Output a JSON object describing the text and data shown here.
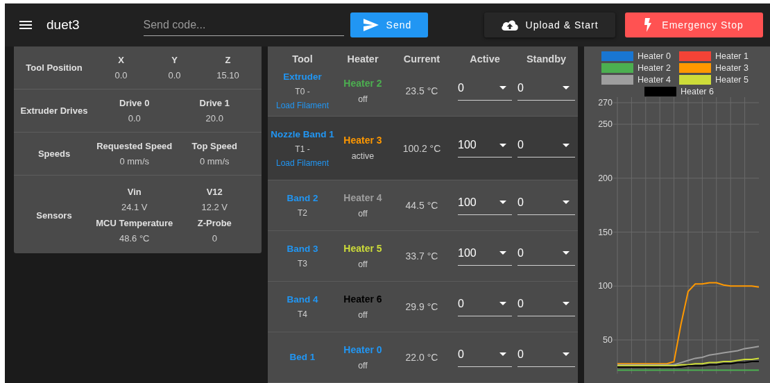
{
  "app_bar": {
    "title": "duet3",
    "code_field": {
      "placeholder": "Send code..."
    },
    "send_button": "Send",
    "upload_button": "Upload & Start",
    "emergency_button": "Emergency Stop"
  },
  "machine_status": {
    "tool_position": {
      "label": "Tool Position",
      "axes": [
        {
          "heading": "X",
          "value": "0.0"
        },
        {
          "heading": "Y",
          "value": "0.0"
        },
        {
          "heading": "Z",
          "value": "15.10"
        }
      ]
    },
    "rows": [
      {
        "label": "Extruder Drives",
        "cells": [
          {
            "heading": "Drive 0",
            "value": "0.0"
          },
          {
            "heading": "Drive 1",
            "value": "20.0"
          }
        ]
      },
      {
        "label": "Speeds",
        "cells": [
          {
            "heading": "Requested Speed",
            "value": "0 mm/s"
          },
          {
            "heading": "Top Speed",
            "value": "0 mm/s"
          }
        ]
      },
      {
        "label": "Sensors",
        "cells": [
          {
            "heading": "Vin",
            "value": "24.1 V"
          },
          {
            "heading": "V12",
            "value": "12.2 V"
          },
          {
            "heading": "MCU Temperature",
            "value": "48.6 °C"
          },
          {
            "heading": "Z-Probe",
            "value": "0"
          }
        ]
      }
    ]
  },
  "tools_table": {
    "columns": [
      "Tool",
      "Heater",
      "Current",
      "Active",
      "Standby"
    ],
    "rows": [
      {
        "name": "Extruder",
        "number": "T0 -",
        "link": "Load Filament",
        "heater": {
          "name": "Heater 2",
          "color": "#4caf50",
          "state": "off"
        },
        "current": "23.5 °C",
        "active": "0",
        "standby": "0",
        "selected": false
      },
      {
        "name": "Nozzle Band 1",
        "number": "T1 -",
        "link": "Load Filament",
        "heater": {
          "name": "Heater 3",
          "color": "#ff9800",
          "state": "active"
        },
        "current": "100.2 °C",
        "active": "100",
        "standby": "0",
        "selected": true
      },
      {
        "name": "Band 2",
        "number": "T2",
        "heater": {
          "name": "Heater 4",
          "color": "#9e9e9e",
          "state": "off"
        },
        "current": "44.5 °C",
        "active": "100",
        "standby": "0",
        "selected": false
      },
      {
        "name": "Band 3",
        "number": "T3",
        "heater": {
          "name": "Heater 5",
          "color": "#cddc39",
          "state": "off"
        },
        "current": "33.7 °C",
        "active": "100",
        "standby": "0",
        "selected": false
      },
      {
        "name": "Band 4",
        "number": "T4",
        "heater": {
          "name": "Heater 6",
          "color": "#000000",
          "state": "off"
        },
        "current": "29.9 °C",
        "active": "0",
        "standby": "0",
        "selected": false
      },
      {
        "name": "Bed 1",
        "heater": {
          "name": "Heater 0",
          "color": "#2196f3",
          "state": "off"
        },
        "current": "22.0 °C",
        "active": "0",
        "standby": "0",
        "selected": false
      }
    ]
  },
  "temperature_chart": {
    "chart_data": {
      "type": "line",
      "grid": true,
      "ylim": [
        20,
        270
      ],
      "yticks": [
        50,
        100,
        150,
        200,
        250,
        270
      ],
      "series": [
        {
          "name": "Heater 0",
          "color": "#1976d2",
          "values": [
            null,
            null,
            null,
            null,
            null,
            null,
            null,
            null,
            null,
            null,
            null,
            null,
            null,
            null,
            null,
            null,
            null,
            null,
            null,
            null,
            null
          ]
        },
        {
          "name": "Heater 1",
          "color": "#f44336",
          "values": [
            null,
            null,
            null,
            null,
            null,
            null,
            null,
            null,
            null,
            null,
            null,
            null,
            null,
            null,
            null,
            null,
            null,
            null,
            null,
            null,
            null
          ]
        },
        {
          "name": "Heater 2",
          "color": "#4caf50",
          "values": [
            22,
            22,
            22,
            22,
            22,
            22,
            22,
            22,
            22,
            22,
            22,
            22,
            22,
            22,
            22,
            22,
            22,
            22,
            22,
            22,
            22
          ]
        },
        {
          "name": "Heater 3",
          "color": "#ff9800",
          "values": [
            28,
            28,
            28,
            28,
            28,
            28,
            28,
            28,
            30,
            65,
            95,
            102,
            102,
            103,
            103,
            101,
            100,
            100,
            100,
            100,
            99
          ]
        },
        {
          "name": "Heater 4",
          "color": "#9e9e9e",
          "values": [
            27,
            27,
            27,
            27,
            27,
            27,
            27,
            27,
            27,
            29,
            31,
            33,
            34,
            36,
            37,
            38,
            39,
            40,
            42,
            43,
            44
          ]
        },
        {
          "name": "Heater 5",
          "color": "#cddc39",
          "values": [
            26,
            26,
            26,
            26,
            26,
            26,
            26,
            26,
            26,
            27,
            27,
            28,
            28,
            29,
            29,
            30,
            30,
            31,
            32,
            32,
            33
          ]
        },
        {
          "name": "Heater 6",
          "color": "#000000",
          "values": [
            25,
            25,
            25,
            25,
            25,
            25,
            25,
            25,
            25,
            25,
            26,
            26,
            26,
            27,
            27,
            28,
            28,
            29,
            29,
            30,
            30
          ]
        }
      ]
    }
  }
}
